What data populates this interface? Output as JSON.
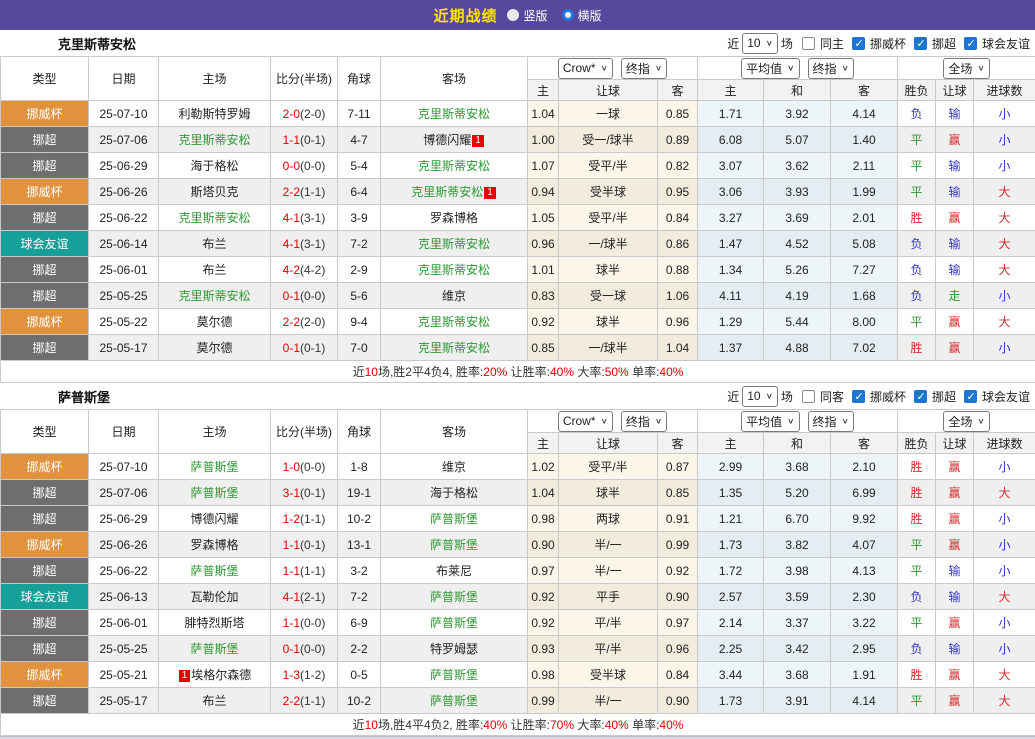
{
  "header": {
    "title": "近期战绩",
    "view_options": [
      {
        "label": "竖版",
        "selected": false
      },
      {
        "label": "横版",
        "selected": true
      }
    ]
  },
  "table": {
    "cols": [
      "类型",
      "日期",
      "主场",
      "比分(半场)",
      "角球",
      "客场"
    ],
    "sub": [
      "主",
      "让球",
      "客",
      "主",
      "和",
      "客",
      "胜负",
      "让球",
      "进球数"
    ],
    "selects": {
      "crow": "Crow*",
      "final1": "终指",
      "avg": "平均值",
      "final2": "终指",
      "full": "全场"
    }
  },
  "colors": {
    "header_bg": "#57489B",
    "title_text": "#FFE400",
    "cup": "#E2913C",
    "league": "#6E6E6E",
    "friendly": "#17A09A",
    "focus_team": "#2E9933",
    "score_red": "#E60000",
    "win_red": "#D92B2B",
    "lose_blue": "#3333CC",
    "draw_green": "#2E9933"
  },
  "sections": [
    {
      "team": "克里斯蒂安松",
      "filters": {
        "near": "近",
        "count": "10",
        "games": "场",
        "same": "同主",
        "same_checked": false,
        "leagues": [
          "挪威杯",
          "挪超",
          "球会友谊"
        ]
      },
      "rows": [
        {
          "type": "挪威杯",
          "tk": "cup",
          "date": "25-07-10",
          "home": "利勒斯特罗姆",
          "hg": false,
          "hb": "",
          "score_ft": "2-0",
          "score_ht": "(2-0)",
          "corner": "7-11",
          "away": "克里斯蒂安松",
          "ag": true,
          "ab": "",
          "odds": [
            "1.04",
            "一球",
            "0.85"
          ],
          "avg": [
            "1.71",
            "3.92",
            "4.14"
          ],
          "res": [
            [
              "负",
              "lose"
            ],
            [
              "输",
              "lose"
            ],
            [
              "小",
              "small"
            ]
          ]
        },
        {
          "type": "挪超",
          "tk": "league",
          "date": "25-07-06",
          "home": "克里斯蒂安松",
          "hg": true,
          "hb": "",
          "score_ft": "1-1",
          "score_ht": "(0-1)",
          "corner": "4-7",
          "away": "博德闪耀",
          "ag": false,
          "ab": "1",
          "odds": [
            "1.00",
            "受一/球半",
            "0.89"
          ],
          "avg": [
            "6.08",
            "5.07",
            "1.40"
          ],
          "res": [
            [
              "平",
              "draw"
            ],
            [
              "赢",
              "win"
            ],
            [
              "小",
              "small"
            ]
          ]
        },
        {
          "type": "挪超",
          "tk": "league",
          "date": "25-06-29",
          "home": "海于格松",
          "hg": false,
          "hb": "",
          "score_ft": "0-0",
          "score_ht": "(0-0)",
          "corner": "5-4",
          "away": "克里斯蒂安松",
          "ag": true,
          "ab": "",
          "odds": [
            "1.07",
            "受平/半",
            "0.82"
          ],
          "avg": [
            "3.07",
            "3.62",
            "2.11"
          ],
          "res": [
            [
              "平",
              "draw"
            ],
            [
              "输",
              "lose"
            ],
            [
              "小",
              "small"
            ]
          ]
        },
        {
          "type": "挪威杯",
          "tk": "cup",
          "date": "25-06-26",
          "home": "斯塔贝克",
          "hg": false,
          "hb": "",
          "score_ft": "2-2",
          "score_ht": "(1-1)",
          "corner": "6-4",
          "away": "克里斯蒂安松",
          "ag": true,
          "ab": "1",
          "odds": [
            "0.94",
            "受半球",
            "0.95"
          ],
          "avg": [
            "3.06",
            "3.93",
            "1.99"
          ],
          "res": [
            [
              "平",
              "draw"
            ],
            [
              "输",
              "lose"
            ],
            [
              "大",
              "big"
            ]
          ]
        },
        {
          "type": "挪超",
          "tk": "league",
          "date": "25-06-22",
          "home": "克里斯蒂安松",
          "hg": true,
          "hb": "",
          "score_ft": "4-1",
          "score_ht": "(3-1)",
          "corner": "3-9",
          "away": "罗森博格",
          "ag": false,
          "ab": "",
          "odds": [
            "1.05",
            "受平/半",
            "0.84"
          ],
          "avg": [
            "3.27",
            "3.69",
            "2.01"
          ],
          "res": [
            [
              "胜",
              "win"
            ],
            [
              "赢",
              "win"
            ],
            [
              "大",
              "big"
            ]
          ]
        },
        {
          "type": "球会友谊",
          "tk": "friendly",
          "date": "25-06-14",
          "home": "布兰",
          "hg": false,
          "hb": "",
          "score_ft": "4-1",
          "score_ht": "(3-1)",
          "corner": "7-2",
          "away": "克里斯蒂安松",
          "ag": true,
          "ab": "",
          "odds": [
            "0.96",
            "一/球半",
            "0.86"
          ],
          "avg": [
            "1.47",
            "4.52",
            "5.08"
          ],
          "res": [
            [
              "负",
              "lose"
            ],
            [
              "输",
              "lose"
            ],
            [
              "大",
              "big"
            ]
          ]
        },
        {
          "type": "挪超",
          "tk": "league",
          "date": "25-06-01",
          "home": "布兰",
          "hg": false,
          "hb": "",
          "score_ft": "4-2",
          "score_ht": "(4-2)",
          "corner": "2-9",
          "away": "克里斯蒂安松",
          "ag": true,
          "ab": "",
          "odds": [
            "1.01",
            "球半",
            "0.88"
          ],
          "avg": [
            "1.34",
            "5.26",
            "7.27"
          ],
          "res": [
            [
              "负",
              "lose"
            ],
            [
              "输",
              "lose"
            ],
            [
              "大",
              "big"
            ]
          ]
        },
        {
          "type": "挪超",
          "tk": "league",
          "date": "25-05-25",
          "home": "克里斯蒂安松",
          "hg": true,
          "hb": "",
          "score_ft": "0-1",
          "score_ht": "(0-0)",
          "corner": "5-6",
          "away": "维京",
          "ag": false,
          "ab": "",
          "odds": [
            "0.83",
            "受一球",
            "1.06"
          ],
          "avg": [
            "4.11",
            "4.19",
            "1.68"
          ],
          "res": [
            [
              "负",
              "lose"
            ],
            [
              "走",
              "go"
            ],
            [
              "小",
              "small"
            ]
          ]
        },
        {
          "type": "挪威杯",
          "tk": "cup",
          "date": "25-05-22",
          "home": "莫尔德",
          "hg": false,
          "hb": "",
          "score_ft": "2-2",
          "score_ht": "(2-0)",
          "corner": "9-4",
          "away": "克里斯蒂安松",
          "ag": true,
          "ab": "",
          "odds": [
            "0.92",
            "球半",
            "0.96"
          ],
          "avg": [
            "1.29",
            "5.44",
            "8.00"
          ],
          "res": [
            [
              "平",
              "draw"
            ],
            [
              "赢",
              "win"
            ],
            [
              "大",
              "big"
            ]
          ]
        },
        {
          "type": "挪超",
          "tk": "league",
          "date": "25-05-17",
          "home": "莫尔德",
          "hg": false,
          "hb": "",
          "score_ft": "0-1",
          "score_ht": "(0-1)",
          "corner": "7-0",
          "away": "克里斯蒂安松",
          "ag": true,
          "ab": "",
          "odds": [
            "0.85",
            "一/球半",
            "1.04"
          ],
          "avg": [
            "1.37",
            "4.88",
            "7.02"
          ],
          "res": [
            [
              "胜",
              "win"
            ],
            [
              "赢",
              "win"
            ],
            [
              "小",
              "small"
            ]
          ]
        }
      ],
      "summary": [
        [
          "近",
          "b"
        ],
        [
          "10",
          "r"
        ],
        [
          "场,胜2平4负4, 胜率:",
          "b"
        ],
        [
          "20%",
          "r"
        ],
        [
          " 让胜率:",
          "b"
        ],
        [
          "40%",
          "r"
        ],
        [
          " 大率:",
          "b"
        ],
        [
          "50%",
          "r"
        ],
        [
          " 单率:",
          "b"
        ],
        [
          "40%",
          "r"
        ]
      ]
    },
    {
      "team": "萨普斯堡",
      "filters": {
        "near": "近",
        "count": "10",
        "games": "场",
        "same": "同客",
        "same_checked": false,
        "leagues": [
          "挪威杯",
          "挪超",
          "球会友谊"
        ]
      },
      "rows": [
        {
          "type": "挪威杯",
          "tk": "cup",
          "date": "25-07-10",
          "home": "萨普斯堡",
          "hg": true,
          "hb": "",
          "score_ft": "1-0",
          "score_ht": "(0-0)",
          "corner": "1-8",
          "away": "维京",
          "ag": false,
          "ab": "",
          "odds": [
            "1.02",
            "受平/半",
            "0.87"
          ],
          "avg": [
            "2.99",
            "3.68",
            "2.10"
          ],
          "res": [
            [
              "胜",
              "win"
            ],
            [
              "赢",
              "win"
            ],
            [
              "小",
              "small"
            ]
          ]
        },
        {
          "type": "挪超",
          "tk": "league",
          "date": "25-07-06",
          "home": "萨普斯堡",
          "hg": true,
          "hb": "",
          "score_ft": "3-1",
          "score_ht": "(0-1)",
          "corner": "19-1",
          "away": "海于格松",
          "ag": false,
          "ab": "",
          "odds": [
            "1.04",
            "球半",
            "0.85"
          ],
          "avg": [
            "1.35",
            "5.20",
            "6.99"
          ],
          "res": [
            [
              "胜",
              "win"
            ],
            [
              "赢",
              "win"
            ],
            [
              "大",
              "big"
            ]
          ]
        },
        {
          "type": "挪超",
          "tk": "league",
          "date": "25-06-29",
          "home": "博德闪耀",
          "hg": false,
          "hb": "",
          "score_ft": "1-2",
          "score_ht": "(1-1)",
          "corner": "10-2",
          "away": "萨普斯堡",
          "ag": true,
          "ab": "",
          "odds": [
            "0.98",
            "两球",
            "0.91"
          ],
          "avg": [
            "1.21",
            "6.70",
            "9.92"
          ],
          "res": [
            [
              "胜",
              "win"
            ],
            [
              "赢",
              "win"
            ],
            [
              "小",
              "small"
            ]
          ]
        },
        {
          "type": "挪威杯",
          "tk": "cup",
          "date": "25-06-26",
          "home": "罗森博格",
          "hg": false,
          "hb": "",
          "score_ft": "1-1",
          "score_ht": "(0-1)",
          "corner": "13-1",
          "away": "萨普斯堡",
          "ag": true,
          "ab": "",
          "odds": [
            "0.90",
            "半/一",
            "0.99"
          ],
          "avg": [
            "1.73",
            "3.82",
            "4.07"
          ],
          "res": [
            [
              "平",
              "draw"
            ],
            [
              "赢",
              "win"
            ],
            [
              "小",
              "small"
            ]
          ]
        },
        {
          "type": "挪超",
          "tk": "league",
          "date": "25-06-22",
          "home": "萨普斯堡",
          "hg": true,
          "hb": "",
          "score_ft": "1-1",
          "score_ht": "(1-1)",
          "corner": "3-2",
          "away": "布莱尼",
          "ag": false,
          "ab": "",
          "odds": [
            "0.97",
            "半/一",
            "0.92"
          ],
          "avg": [
            "1.72",
            "3.98",
            "4.13"
          ],
          "res": [
            [
              "平",
              "draw"
            ],
            [
              "输",
              "lose"
            ],
            [
              "小",
              "small"
            ]
          ]
        },
        {
          "type": "球会友谊",
          "tk": "friendly",
          "date": "25-06-13",
          "home": "瓦勒伦加",
          "hg": false,
          "hb": "",
          "score_ft": "4-1",
          "score_ht": "(2-1)",
          "corner": "7-2",
          "away": "萨普斯堡",
          "ag": true,
          "ab": "",
          "odds": [
            "0.92",
            "平手",
            "0.90"
          ],
          "avg": [
            "2.57",
            "3.59",
            "2.30"
          ],
          "res": [
            [
              "负",
              "lose"
            ],
            [
              "输",
              "lose"
            ],
            [
              "大",
              "big"
            ]
          ]
        },
        {
          "type": "挪超",
          "tk": "league",
          "date": "25-06-01",
          "home": "腓特烈斯塔",
          "hg": false,
          "hb": "",
          "score_ft": "1-1",
          "score_ht": "(0-0)",
          "corner": "6-9",
          "away": "萨普斯堡",
          "ag": true,
          "ab": "",
          "odds": [
            "0.92",
            "平/半",
            "0.97"
          ],
          "avg": [
            "2.14",
            "3.37",
            "3.22"
          ],
          "res": [
            [
              "平",
              "draw"
            ],
            [
              "赢",
              "win"
            ],
            [
              "小",
              "small"
            ]
          ]
        },
        {
          "type": "挪超",
          "tk": "league",
          "date": "25-05-25",
          "home": "萨普斯堡",
          "hg": true,
          "hb": "",
          "score_ft": "0-1",
          "score_ht": "(0-0)",
          "corner": "2-2",
          "away": "特罗姆瑟",
          "ag": false,
          "ab": "",
          "odds": [
            "0.93",
            "平/半",
            "0.96"
          ],
          "avg": [
            "2.25",
            "3.42",
            "2.95"
          ],
          "res": [
            [
              "负",
              "lose"
            ],
            [
              "输",
              "lose"
            ],
            [
              "小",
              "small"
            ]
          ]
        },
        {
          "type": "挪威杯",
          "tk": "cup",
          "date": "25-05-21",
          "home": "埃格尔森德",
          "hg": false,
          "hb": "1",
          "hbp": "before",
          "score_ft": "1-3",
          "score_ht": "(1-2)",
          "corner": "0-5",
          "away": "萨普斯堡",
          "ag": true,
          "ab": "",
          "odds": [
            "0.98",
            "受半球",
            "0.84"
          ],
          "avg": [
            "3.44",
            "3.68",
            "1.91"
          ],
          "res": [
            [
              "胜",
              "win"
            ],
            [
              "赢",
              "win"
            ],
            [
              "大",
              "big"
            ]
          ]
        },
        {
          "type": "挪超",
          "tk": "league",
          "date": "25-05-17",
          "home": "布兰",
          "hg": false,
          "hb": "",
          "score_ft": "2-2",
          "score_ht": "(1-1)",
          "corner": "10-2",
          "away": "萨普斯堡",
          "ag": true,
          "ab": "",
          "odds": [
            "0.99",
            "半/一",
            "0.90"
          ],
          "avg": [
            "1.73",
            "3.91",
            "4.14"
          ],
          "res": [
            [
              "平",
              "draw"
            ],
            [
              "赢",
              "win"
            ],
            [
              "大",
              "big"
            ]
          ]
        }
      ],
      "summary": [
        [
          "近",
          "b"
        ],
        [
          "10",
          "r"
        ],
        [
          "场,胜4平4负2, 胜率:",
          "b"
        ],
        [
          "40%",
          "r"
        ],
        [
          " 让胜率:",
          "b"
        ],
        [
          "70%",
          "r"
        ],
        [
          " 大率:",
          "b"
        ],
        [
          "40%",
          "r"
        ],
        [
          " 单率:",
          "b"
        ],
        [
          "40%",
          "r"
        ]
      ]
    }
  ]
}
